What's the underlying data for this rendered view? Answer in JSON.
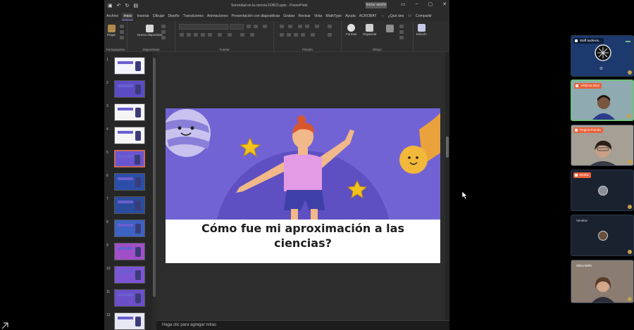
{
  "window": {
    "title": "Sororidad en la ciencia FDB22.pptx  -  PowerPoint",
    "signin_label": "Iniciar sesión",
    "controls": [
      "▭",
      "–",
      "▢",
      "✕"
    ]
  },
  "menu": {
    "tabs": [
      "Archivo",
      "Inicio",
      "Insertar",
      "Dibujar",
      "Diseño",
      "Transiciones",
      "Animaciones",
      "Presentación con diapositivas",
      "Grabar",
      "Revisar",
      "Vista",
      "MathType",
      "Ayuda",
      "ACROBAT"
    ],
    "active": "Inicio",
    "tell_me": "¿Qué des",
    "share": "Compartir"
  },
  "ribbon": {
    "groups": [
      {
        "label": "Portapapeles",
        "buttons": [
          "Pegar"
        ]
      },
      {
        "label": "Diapositivas",
        "buttons": [
          "Nueva diapositiva"
        ]
      },
      {
        "label": "Fuente"
      },
      {
        "label": "Párrafo"
      },
      {
        "label": "Dibujo",
        "buttons": [
          "Formas",
          "Organizar"
        ]
      },
      {
        "label": "",
        "buttons": [
          "Edición"
        ]
      }
    ]
  },
  "thumbnails": [
    {
      "num": "1",
      "bg": "#f3f3fb"
    },
    {
      "num": "2",
      "bg": "#5b4cc4"
    },
    {
      "num": "3",
      "bg": "#f5f5f5"
    },
    {
      "num": "4",
      "bg": "#f5f5f5"
    },
    {
      "num": "5",
      "bg": "#6a55d0"
    },
    {
      "num": "6",
      "bg": "#2b4fa8"
    },
    {
      "num": "7",
      "bg": "#2a4c9c"
    },
    {
      "num": "8",
      "bg": "#3c62c2"
    },
    {
      "num": "9",
      "bg": "#a14fc8"
    },
    {
      "num": "10",
      "bg": "#7c55d4"
    },
    {
      "num": "11",
      "bg": "#6a4fc8"
    },
    {
      "num": "12",
      "bg": "#e8e8f4"
    }
  ],
  "selected_thumbnail": "5",
  "slide": {
    "title_line1": "Cómo fue mi aproximación a las",
    "title_line2": "ciencias?",
    "bg_color": "#7263d4"
  },
  "notes_placeholder": "Haga clic para agregar notas",
  "participants": [
    {
      "name": "Staff audiovis...",
      "type": "icon"
    },
    {
      "name": "Yéttzma Díaz",
      "type": "video"
    },
    {
      "name": "Regina Pomda",
      "type": "video"
    },
    {
      "name": "Nelsia",
      "type": "avatar"
    },
    {
      "name": "Venelse",
      "type": "avatar"
    },
    {
      "name": "Silvia Bello",
      "type": "video"
    }
  ]
}
